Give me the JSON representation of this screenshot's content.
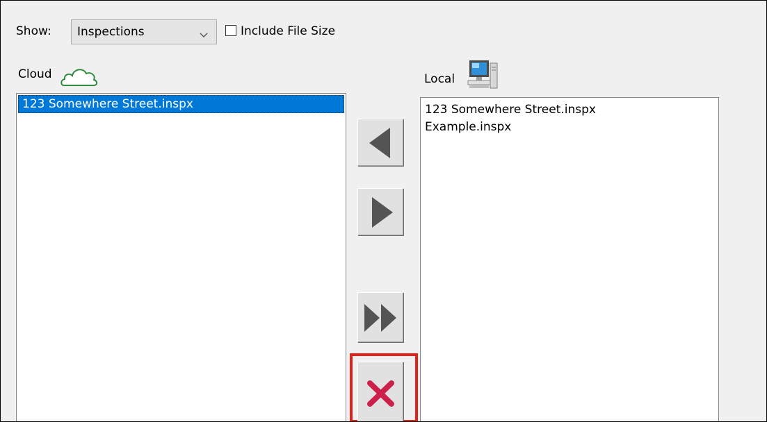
{
  "toolbar": {
    "show_label": "Show:",
    "show_value": "Inspections",
    "include_size_label": "Include File Size",
    "include_size_checked": false
  },
  "cloud": {
    "label": "Cloud",
    "icon": "cloud-icon",
    "items": [
      {
        "name": "123 Somewhere Street.inspx",
        "selected": true
      }
    ]
  },
  "local": {
    "label": "Local",
    "icon": "computer-icon",
    "items": [
      {
        "name": "123 Somewhere Street.inspx"
      },
      {
        "name": "Example.inspx"
      }
    ]
  },
  "buttons": {
    "download": "left-arrow-icon",
    "upload": "right-arrow-icon",
    "upload_all": "double-right-arrow-icon",
    "delete": "red-x-icon"
  },
  "colors": {
    "selection": "#0078d7",
    "highlight": "#e2231a",
    "delete_icon": "#cc1f4a",
    "cloud_icon": "#2e8b3d"
  }
}
